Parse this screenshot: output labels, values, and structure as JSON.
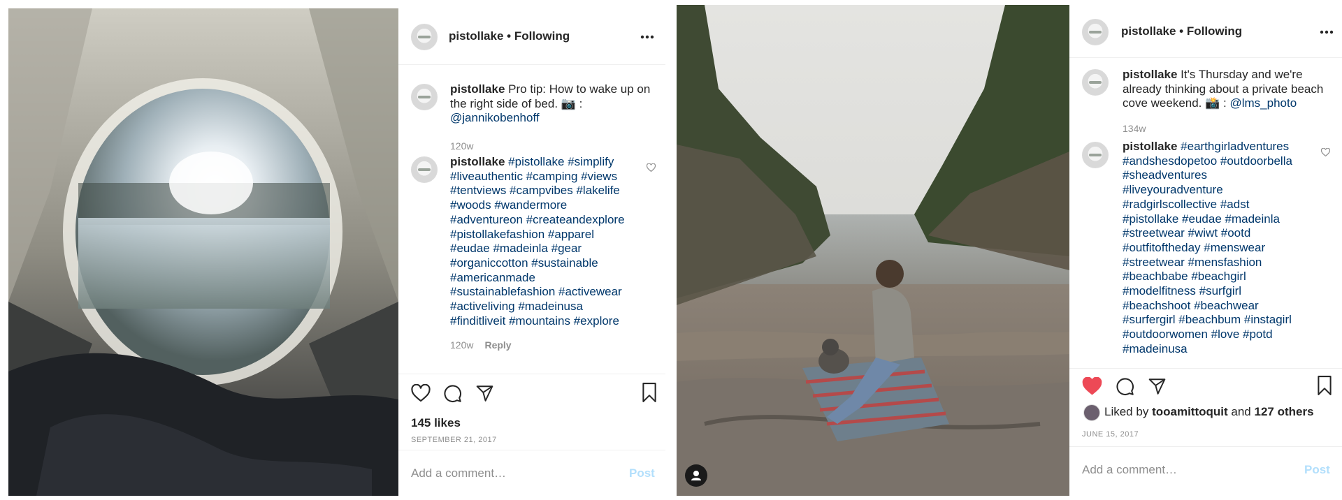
{
  "post1": {
    "username": "pistollake",
    "follow_state": "Following",
    "more_icon": "more-horizontal-icon",
    "caption_text": "Pro tip: How to wake up on the right side of bed. 📷 :",
    "caption_mention": "@jannikobenhoff",
    "caption_age": "120w",
    "comment_lines": [
      "#pistollake #simplify",
      "#liveauthentic #camping #views",
      "#tentviews #campvibes #lakelife",
      "#woods #wandermore",
      "#adventureon #createandexplore",
      "#pistollakefashion #apparel",
      "#eudae #madeinla #gear",
      "#organiccotton #sustainable",
      "#americanmade",
      "#sustainablefashion #activewear",
      "#activeliving #madeinusa",
      "#finditliveit #mountains #explore"
    ],
    "comment_age": "120w",
    "reply_label": "Reply",
    "likes": "145 likes",
    "date": "September 21, 2017",
    "comment_placeholder": "Add a comment…",
    "post_label": "Post"
  },
  "post2": {
    "username": "pistollake",
    "follow_state": "Following",
    "more_icon": "more-horizontal-icon",
    "caption_text": "It's Thursday and we're already thinking about a private beach cove weekend. 📸 :",
    "caption_mention": "@lms_photo",
    "caption_age": "134w",
    "comment_lines": [
      "#earthgirladventures",
      "#andshesdopetoo #outdoorbella",
      "#sheadventures",
      "#liveyouradventure",
      "#radgirlscollective #adst",
      "#pistollake #eudae #madeinla",
      "#streetwear #wiwt #ootd",
      "#outfitoftheday #menswear",
      "#streetwear #mensfashion",
      "#beachbabe #beachgirl",
      "#modelfitness #surfgirl",
      "#beachshoot #beachwear",
      "#surfergirl #beachbum #instagirl",
      "#outdoorwomen #love #potd",
      "#madeinusa"
    ],
    "liked_by_prefix": "Liked by",
    "liked_by_user": "tooamittoquit",
    "liked_by_and": "and",
    "liked_by_others": "127 others",
    "date": "June 15, 2017",
    "comment_placeholder": "Add a comment…",
    "post_label": "Post",
    "like_color": "#ed4956"
  }
}
